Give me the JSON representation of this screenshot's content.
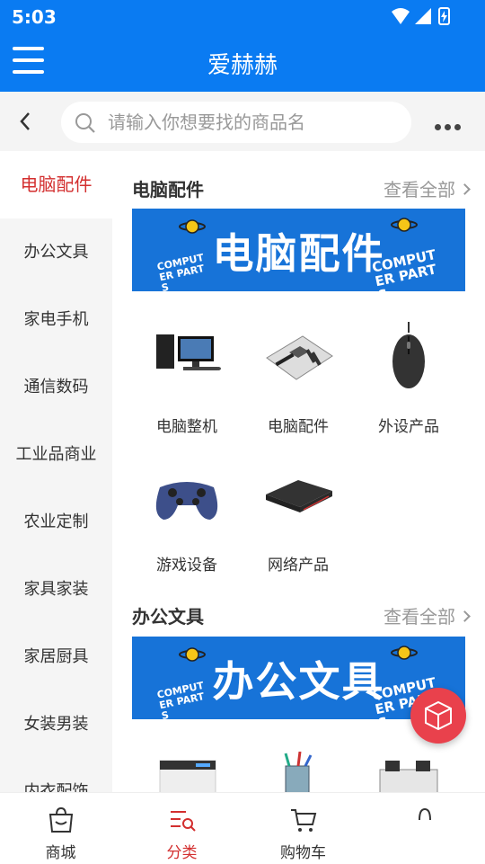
{
  "status": {
    "time": "5:03"
  },
  "appbar": {
    "title": "爱赫赫"
  },
  "search": {
    "placeholder": "请输入你想要找的商品名"
  },
  "sidebar": {
    "items": [
      {
        "label": "电脑配件"
      },
      {
        "label": "办公文具"
      },
      {
        "label": "家电手机"
      },
      {
        "label": "通信数码"
      },
      {
        "label": "工业品商业"
      },
      {
        "label": "农业定制"
      },
      {
        "label": "家具家装"
      },
      {
        "label": "家居厨具"
      },
      {
        "label": "女装男装"
      },
      {
        "label": "内衣配饰"
      }
    ],
    "active_index": 0
  },
  "sections": [
    {
      "title": "电脑配件",
      "view_all": "查看全部",
      "banner": {
        "text": "电脑配件",
        "tag": "COMPUTER PARTS"
      },
      "items": [
        {
          "label": "电脑整机",
          "icon": "desktop-pc-icon"
        },
        {
          "label": "电脑配件",
          "icon": "motherboard-icon"
        },
        {
          "label": "外设产品",
          "icon": "mouse-icon"
        },
        {
          "label": "游戏设备",
          "icon": "gamepad-icon"
        },
        {
          "label": "网络产品",
          "icon": "router-icon"
        }
      ]
    },
    {
      "title": "办公文具",
      "view_all": "查看全部",
      "banner": {
        "text": "办公文具",
        "tag": "COMPUTER PARTS"
      },
      "items": [
        {
          "label": "",
          "icon": "printer-icon"
        },
        {
          "label": "",
          "icon": "stationery-icon"
        },
        {
          "label": "",
          "icon": "office-desk-icon"
        }
      ]
    }
  ],
  "tabbar": {
    "items": [
      {
        "label": "商城",
        "icon": "shopping-bag-icon"
      },
      {
        "label": "分类",
        "icon": "category-search-icon"
      },
      {
        "label": "购物车",
        "icon": "cart-icon"
      },
      {
        "label": "",
        "icon": "user-icon"
      }
    ],
    "active_index": 1
  },
  "colors": {
    "primary": "#0a7bf2",
    "accent": "#d32f2f",
    "banner": "#1773d8",
    "fab": "#e9414c"
  }
}
